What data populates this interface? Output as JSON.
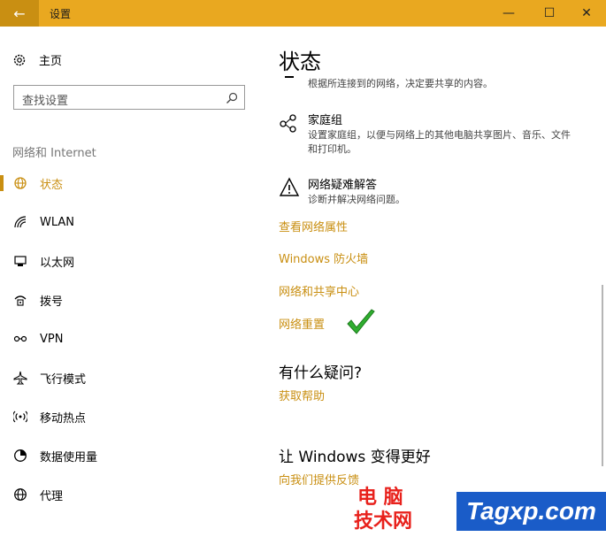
{
  "window": {
    "title": "设置",
    "back_glyph": "←",
    "minimize_glyph": "—",
    "maximize_glyph": "☐",
    "close_glyph": "✕",
    "accent_color": "#e9a820"
  },
  "sidebar": {
    "home_label": "主页",
    "search_placeholder": "查找设置",
    "section_label": "网络和 Internet",
    "items": [
      {
        "label": "状态",
        "icon": "status-globe-icon",
        "active": true
      },
      {
        "label": "WLAN",
        "icon": "wifi-icon"
      },
      {
        "label": "以太网",
        "icon": "ethernet-icon"
      },
      {
        "label": "拨号",
        "icon": "dialup-icon"
      },
      {
        "label": "VPN",
        "icon": "vpn-icon"
      },
      {
        "label": "飞行模式",
        "icon": "airplane-icon"
      },
      {
        "label": "移动热点",
        "icon": "hotspot-icon"
      },
      {
        "label": "数据使用量",
        "icon": "data-usage-icon"
      },
      {
        "label": "代理",
        "icon": "globe-icon"
      }
    ]
  },
  "main": {
    "title": "状态",
    "partial_text": "根据所连接到的网络，决定要共享的内容。",
    "homegroup": {
      "title": "家庭组",
      "desc": "设置家庭组，以便与网络上的其他电脑共享图片、音乐、文件和打印机。"
    },
    "troubleshoot": {
      "title": "网络疑难解答",
      "desc": "诊断并解决网络问题。"
    },
    "links": {
      "properties": "查看网络属性",
      "firewall": "Windows 防火墙",
      "sharing_center": "网络和共享中心",
      "reset": "网络重置"
    },
    "questions_heading": "有什么疑问?",
    "get_help": "获取帮助",
    "feedback_heading": "让 Windows 变得更好",
    "feedback_link": "向我们提供反馈"
  },
  "watermark": {
    "cn_line1": "电 脑",
    "cn_line2": "技术网",
    "en": "Tagxp.com"
  }
}
